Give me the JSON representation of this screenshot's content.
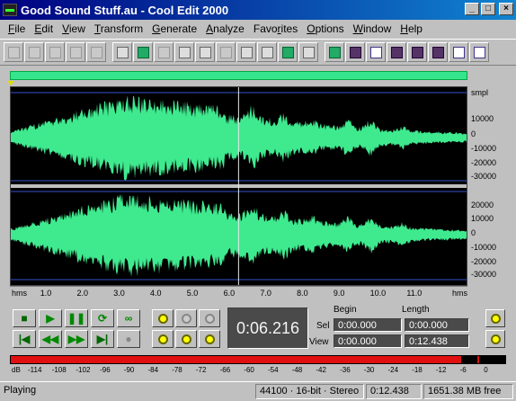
{
  "window": {
    "title": "Good Sound Stuff.au - Cool Edit 2000"
  },
  "menu": [
    "File",
    "Edit",
    "View",
    "Transform",
    "Generate",
    "Analyze",
    "Favorites",
    "Options",
    "Window",
    "Help"
  ],
  "menu_access": [
    "F",
    "E",
    "V",
    "T",
    "G",
    "A",
    "r",
    "O",
    "W",
    "H"
  ],
  "toolbar_icons": [
    "new-icon",
    "open-icon",
    "close-file-icon",
    "save-icon",
    "save-all-icon",
    "undo-icon",
    "redo-icon",
    "cut-silence-icon",
    "insert-icon",
    "copy-icon",
    "cut-icon",
    "paste-icon",
    "mix-paste-icon",
    "spectral-view-icon",
    "trim-icon",
    "loop-icon",
    "waveform-view-icon",
    "checkbox-icon",
    "grid-icon",
    "multitrack-icon",
    "cue-list-icon",
    "favorites-icon",
    "properties-icon"
  ],
  "waveform": {
    "y_unit": "smpl",
    "ch1_ticks": [
      "10000",
      "0",
      "-10000",
      "-20000",
      "-30000"
    ],
    "ch2_ticks": [
      "20000",
      "10000",
      "0",
      "-10000",
      "-20000",
      "-30000"
    ],
    "x_unit": "hms",
    "x_ticks": [
      "1.0",
      "2.0",
      "3.0",
      "4.0",
      "5.0",
      "6.0",
      "7.0",
      "8.0",
      "9.0",
      "10.0",
      "11.0"
    ],
    "cursor_time": 6.216,
    "duration": 12.438,
    "wave_color": "#3fea8f"
  },
  "transport": {
    "buttons": [
      "stop",
      "play",
      "pause",
      "play-looped",
      "loop",
      "go-to-start",
      "rewind",
      "fast-forward",
      "go-to-end",
      "record"
    ]
  },
  "time_display": "0:06.216",
  "selection": {
    "begin_header": "Begin",
    "length_header": "Length",
    "sel_label": "Sel",
    "view_label": "View",
    "sel_begin": "0:00.000",
    "sel_length": "0:00.000",
    "view_begin": "0:00.000",
    "view_length": "0:12.438"
  },
  "levels": {
    "db_label": "dB",
    "scale": [
      "-114",
      "-108",
      "-102",
      "-96",
      "-90",
      "-84",
      "-78",
      "-72",
      "-66",
      "-60",
      "-54",
      "-48",
      "-42",
      "-36",
      "-30",
      "-24",
      "-18",
      "-12",
      "-6",
      "0"
    ],
    "level_fraction": 0.91
  },
  "status": {
    "state": "Playing",
    "format": "44100 · 16-bit · Stereo",
    "length": "0:12.438",
    "free": "1651.38 MB free"
  }
}
